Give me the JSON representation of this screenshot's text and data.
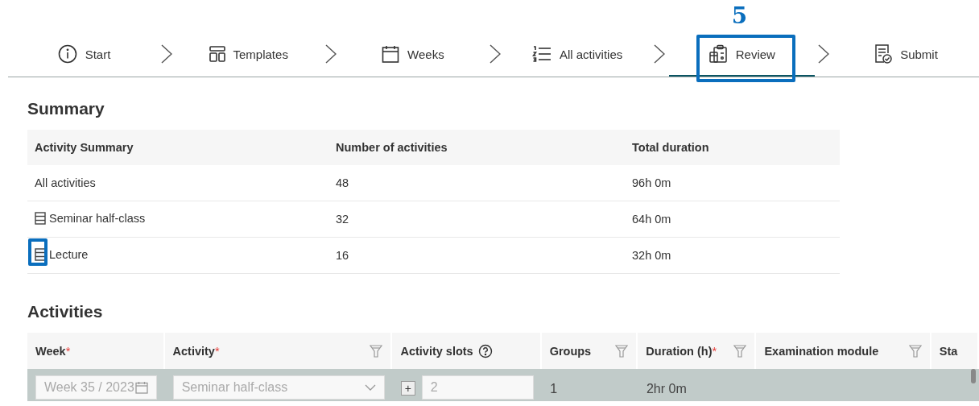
{
  "steps": [
    {
      "label": "Start",
      "selected": false,
      "highlighted": false
    },
    {
      "label": "Templates",
      "selected": false,
      "highlighted": false
    },
    {
      "label": "Weeks",
      "selected": false,
      "highlighted": false
    },
    {
      "label": "All activities",
      "selected": false,
      "highlighted": false
    },
    {
      "label": "Review",
      "selected": true,
      "highlighted": true,
      "callout": "5"
    },
    {
      "label": "Submit",
      "selected": false,
      "highlighted": false
    }
  ],
  "summary": {
    "title": "Summary",
    "columns": [
      "Activity Summary",
      "Number of activities",
      "Total duration"
    ],
    "rows": [
      {
        "activity": "All activities",
        "has_icon": false,
        "icon_highlighted": false,
        "count": "48",
        "duration": "96h 0m"
      },
      {
        "activity": "Seminar half-class",
        "has_icon": true,
        "icon_highlighted": false,
        "count": "32",
        "duration": "64h 0m"
      },
      {
        "activity": "Lecture",
        "has_icon": true,
        "icon_highlighted": true,
        "count": "16",
        "duration": "32h 0m"
      }
    ]
  },
  "activities": {
    "title": "Activities",
    "columns": [
      {
        "label": "Week",
        "required_mark": "*",
        "filter": false,
        "help": false
      },
      {
        "label": "Activity",
        "required_mark": "*",
        "filter": true,
        "help": false
      },
      {
        "label": "Activity slots",
        "filter": false,
        "help": true
      },
      {
        "label": "Groups",
        "filter": true,
        "help": false
      },
      {
        "label": "Duration (h)",
        "required_mark": "*",
        "filter": true,
        "help": false
      },
      {
        "label": "Examination module",
        "filter": true,
        "help": false
      },
      {
        "label": "Sta",
        "filter": false,
        "help": false
      }
    ],
    "rows": [
      {
        "week": "Week 35 / 2023",
        "activity": "Seminar half-class",
        "add_label": "+",
        "slots": "2",
        "groups": "1",
        "duration": "2hr 0m",
        "disabled": true
      }
    ]
  }
}
